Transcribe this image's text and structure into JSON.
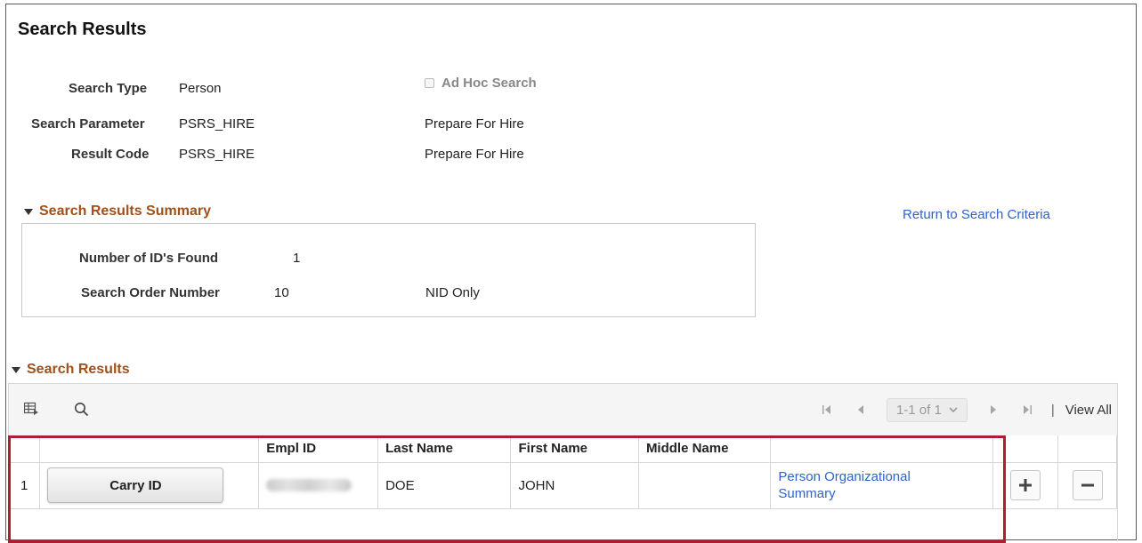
{
  "header": {
    "title": "Search Results"
  },
  "criteria": {
    "search_type_label": "Search Type",
    "search_type_value": "Person",
    "adhoc_label": "Ad Hoc Search",
    "adhoc_checked": false,
    "search_parameter_label": "Search Parameter",
    "search_parameter_value": "PSRS_HIRE",
    "search_parameter_desc": "Prepare For Hire",
    "result_code_label": "Result Code",
    "result_code_value": "PSRS_HIRE",
    "result_code_desc": "Prepare For Hire"
  },
  "summary": {
    "title": "Search Results Summary",
    "return_link": "Return to Search Criteria",
    "ids_found_label": "Number of ID's Found",
    "ids_found_value": "1",
    "order_label": "Search Order Number",
    "order_value": "10",
    "order_desc": "NID Only"
  },
  "results": {
    "title": "Search Results",
    "pager": {
      "range": "1-1 of 1",
      "view_all": "View All",
      "separator": "|"
    },
    "columns": [
      "Empl ID",
      "Last Name",
      "First Name",
      "Middle Name"
    ],
    "rows": [
      {
        "num": "1",
        "action_label": "Carry ID",
        "empl_id": "",
        "last_name": "DOE",
        "first_name": "JOHN",
        "middle_name": "",
        "link": "Person Organizational Summary"
      }
    ]
  },
  "colors": {
    "section_header": "#a0501a",
    "link": "#2e63c9",
    "highlight": "#b01c32"
  },
  "icons": [
    "grid-settings-icon",
    "search-icon",
    "first-page-icon",
    "previous-page-icon",
    "dropdown-chevron-icon",
    "next-page-icon",
    "last-page-icon",
    "add-row-icon",
    "delete-row-icon",
    "collapse-triangle-icon"
  ]
}
